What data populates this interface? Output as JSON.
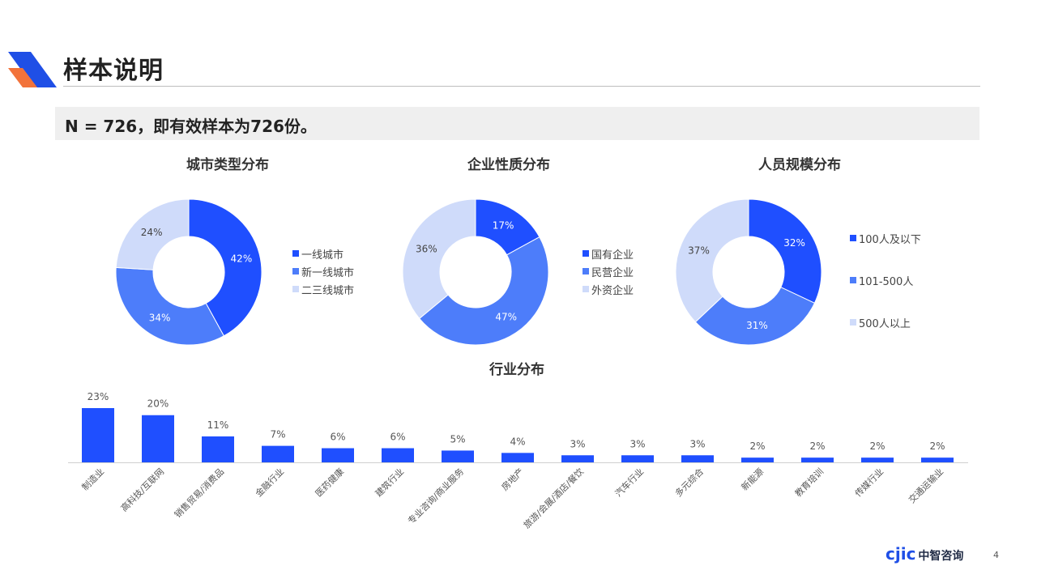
{
  "header": {
    "title": "样本说明"
  },
  "banner": {
    "text": "N = 726，即有效样本为726份。"
  },
  "colors": {
    "dark": "#1f4fff",
    "mid": "#4d7dfa",
    "light": "#cfdbfa",
    "bar": "#1f4fff",
    "accent_orange": "#f2733b"
  },
  "chart_data": [
    {
      "type": "donut",
      "title": "城市类型分布",
      "labels": [
        "一线城市",
        "新一线城市",
        "二三线城市"
      ],
      "values": [
        42,
        34,
        24
      ],
      "value_labels": [
        "42%",
        "34%",
        "24%"
      ]
    },
    {
      "type": "donut",
      "title": "企业性质分布",
      "labels": [
        "国有企业",
        "民营企业",
        "外资企业"
      ],
      "values": [
        17,
        47,
        36
      ],
      "value_labels": [
        "17%",
        "47%",
        "36%"
      ]
    },
    {
      "type": "donut",
      "title": "人员规模分布",
      "labels": [
        "100人及以下",
        "101-500人",
        "500人以上"
      ],
      "values": [
        32,
        31,
        37
      ],
      "value_labels": [
        "32%",
        "31%",
        "37%"
      ]
    },
    {
      "type": "bar",
      "title": "行业分布",
      "categories": [
        "制造业",
        "高科技/互联网",
        "销售贸易/消费品",
        "金融行业",
        "医药健康",
        "建筑行业",
        "专业咨询/商业服务",
        "房地产",
        "旅游/会展/酒店/餐饮",
        "汽车行业",
        "多元综合",
        "新能源",
        "教育培训",
        "传媒行业",
        "交通运输业"
      ],
      "values": [
        23,
        20,
        11,
        7,
        6,
        6,
        5,
        4,
        3,
        3,
        3,
        2,
        2,
        2,
        2
      ],
      "value_labels": [
        "23%",
        "20%",
        "11%",
        "7%",
        "6%",
        "6%",
        "5%",
        "4%",
        "3%",
        "3%",
        "3%",
        "2%",
        "2%",
        "2%",
        "2%"
      ]
    }
  ],
  "footer": {
    "logo_latin": "cjic",
    "logo_cn": "中智咨询",
    "page_number": "4"
  }
}
